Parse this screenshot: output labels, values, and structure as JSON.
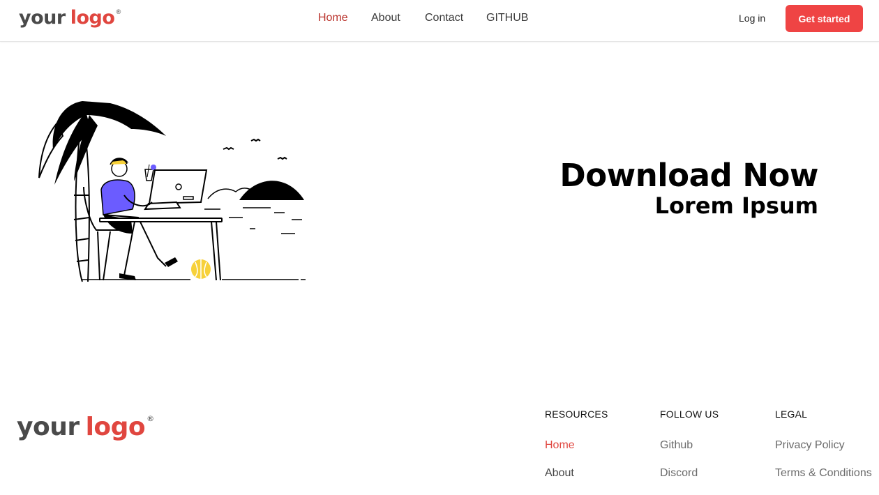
{
  "brand": {
    "logo_word1": "your",
    "logo_word2": "logo",
    "logo_mark": "®",
    "colors": {
      "primary": "#ef4444",
      "logo_accent": "#e0463f",
      "nav_active": "#b9322b",
      "illustration_accent": "#6b5cff",
      "ball": "#f7d13a"
    }
  },
  "nav": {
    "links": [
      "Home",
      "About",
      "Contact",
      "GITHUB"
    ],
    "active": "Home",
    "login": "Log in",
    "cta": "Get started"
  },
  "hero": {
    "title": "Download Now",
    "subtitle": "Lorem Ipsum"
  },
  "footer": {
    "columns": [
      {
        "heading": "RESOURCES",
        "links": [
          "Home",
          "About"
        ]
      },
      {
        "heading": "FOLLOW US",
        "links": [
          "Github",
          "Discord"
        ]
      },
      {
        "heading": "LEGAL",
        "links": [
          "Privacy Policy",
          "Terms & Conditions"
        ]
      }
    ]
  }
}
